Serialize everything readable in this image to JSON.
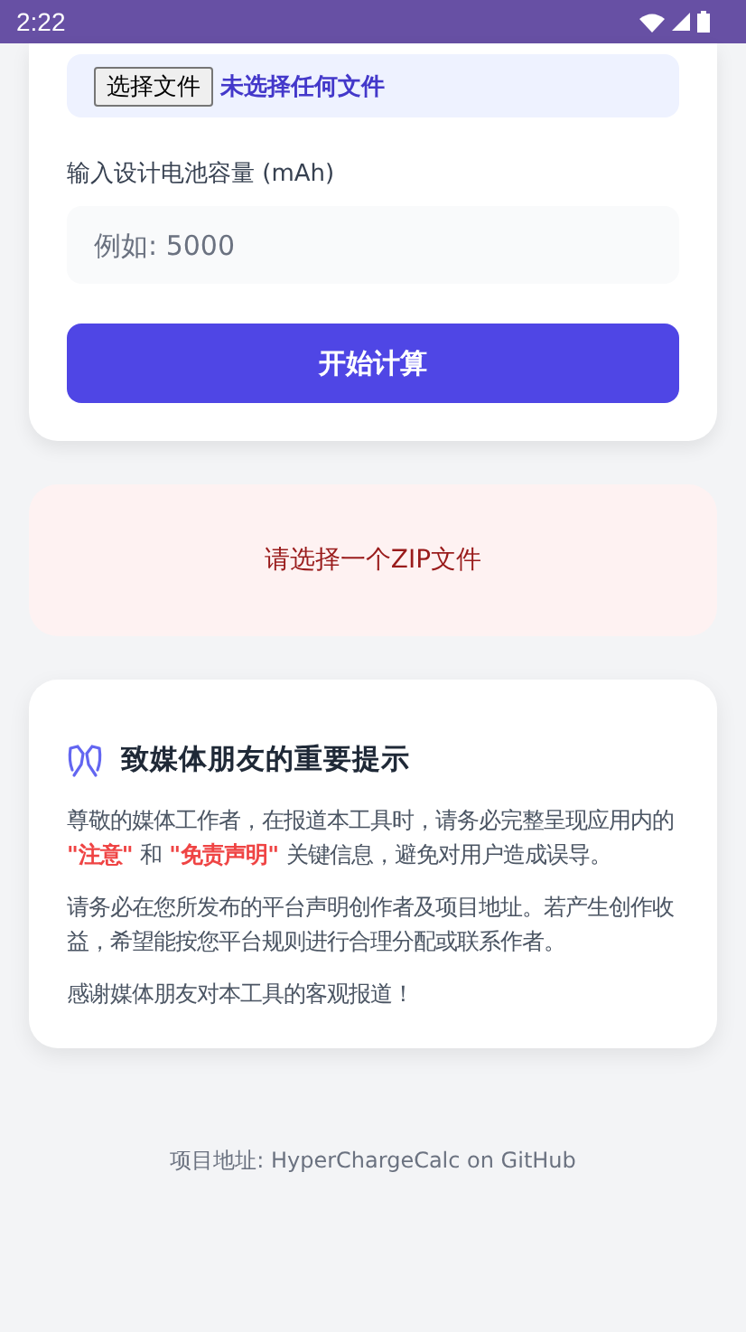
{
  "status_bar": {
    "time": "2:22"
  },
  "upload": {
    "button": "选择文件",
    "file_status": "未选择任何文件"
  },
  "capacity": {
    "label": "输入设计电池容量 (mAh)",
    "placeholder": "例如: 5000"
  },
  "submit": {
    "label": "开始计算"
  },
  "error": {
    "message": "请选择一个ZIP文件"
  },
  "notice": {
    "title": "致媒体朋友的重要提示",
    "paragraphs": [
      "尊敬的媒体工作者，在报道本工具时，请务必完整呈现应用内的 **\"注意\"** 和 **\"免责声明\"** 关键信息，避免对用户造成误导。",
      "请务必在您所发布的平台声明创作者及项目地址。若产生创作收益，希望能按您平台规则进行合理分配或联系作者。",
      "感谢媒体朋友对本工具的客观报道！"
    ]
  },
  "footer": {
    "text": "项目地址: HyperChargeCalc on GitHub"
  }
}
